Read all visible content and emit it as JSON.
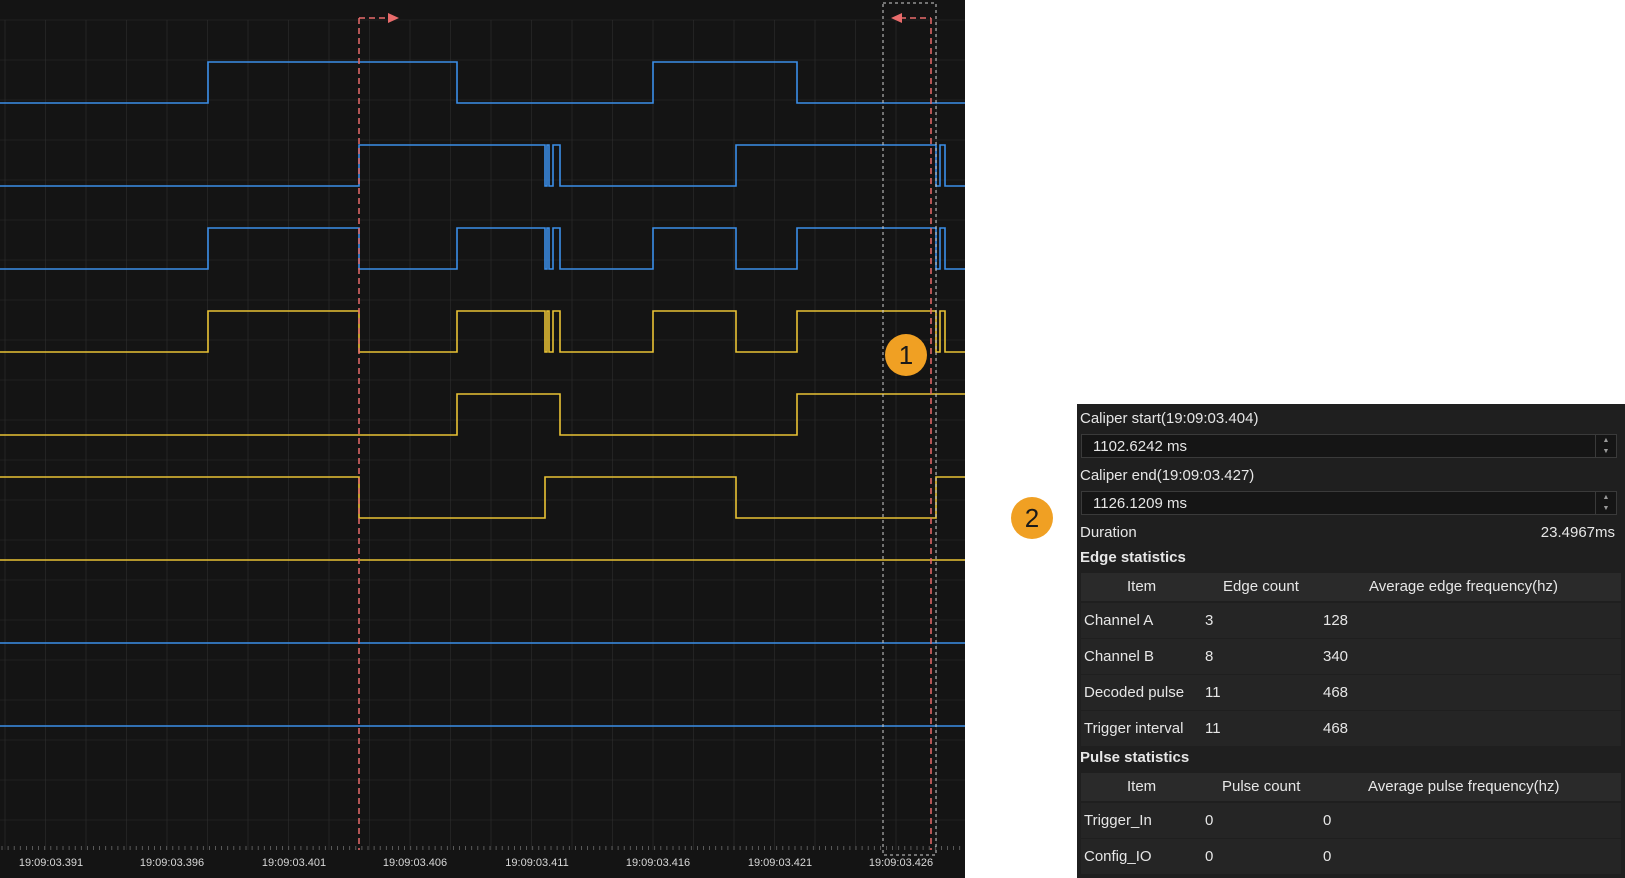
{
  "colors": {
    "blue": "#3b8ee8",
    "yellow": "#e8c234",
    "caliper": "#e86b6b",
    "badge": "#f0a023",
    "grid": "#2e2e2e"
  },
  "waveform": {
    "time_ticks": [
      "19:09:03.391",
      "19:09:03.396",
      "19:09:03.401",
      "19:09:03.406",
      "19:09:03.411",
      "19:09:03.416",
      "19:09:03.421",
      "19:09:03.426"
    ],
    "channels": [
      {
        "color": "blue",
        "segments": [
          [
            0,
            0
          ],
          [
            208,
            0
          ],
          [
            208,
            1
          ],
          [
            457,
            1
          ],
          [
            457,
            0
          ],
          [
            653,
            0
          ],
          [
            653,
            1
          ],
          [
            797,
            1
          ],
          [
            797,
            0
          ],
          [
            965,
            0
          ]
        ]
      },
      {
        "color": "blue",
        "segments": [
          [
            0,
            0
          ],
          [
            359,
            0
          ],
          [
            359,
            1
          ],
          [
            545,
            1
          ],
          [
            545,
            0
          ],
          [
            547,
            0
          ],
          [
            547,
            1
          ],
          [
            549,
            1
          ],
          [
            549,
            0
          ],
          [
            553,
            0
          ],
          [
            553,
            1
          ],
          [
            560,
            1
          ],
          [
            560,
            0
          ],
          [
            736,
            0
          ],
          [
            736,
            1
          ],
          [
            936,
            1
          ],
          [
            936,
            0
          ],
          [
            940,
            0
          ],
          [
            940,
            1
          ],
          [
            945,
            1
          ],
          [
            945,
            0
          ],
          [
            965,
            0
          ]
        ]
      },
      {
        "color": "blue",
        "segments": [
          [
            0,
            0
          ],
          [
            208,
            0
          ],
          [
            208,
            1
          ],
          [
            359,
            1
          ],
          [
            359,
            0
          ],
          [
            457,
            0
          ],
          [
            457,
            1
          ],
          [
            545,
            1
          ],
          [
            545,
            0
          ],
          [
            547,
            0
          ],
          [
            547,
            1
          ],
          [
            549,
            1
          ],
          [
            549,
            0
          ],
          [
            553,
            0
          ],
          [
            553,
            1
          ],
          [
            560,
            1
          ],
          [
            560,
            0
          ],
          [
            653,
            0
          ],
          [
            653,
            1
          ],
          [
            736,
            1
          ],
          [
            736,
            0
          ],
          [
            797,
            0
          ],
          [
            797,
            1
          ],
          [
            936,
            1
          ],
          [
            936,
            0
          ],
          [
            940,
            0
          ],
          [
            940,
            1
          ],
          [
            945,
            1
          ],
          [
            945,
            0
          ],
          [
            965,
            0
          ]
        ]
      },
      {
        "color": "yellow",
        "segments": [
          [
            0,
            0
          ],
          [
            208,
            0
          ],
          [
            208,
            1
          ],
          [
            359,
            1
          ],
          [
            359,
            0
          ],
          [
            457,
            0
          ],
          [
            457,
            1
          ],
          [
            545,
            1
          ],
          [
            545,
            0
          ],
          [
            547,
            0
          ],
          [
            547,
            1
          ],
          [
            549,
            1
          ],
          [
            549,
            0
          ],
          [
            553,
            0
          ],
          [
            553,
            1
          ],
          [
            560,
            1
          ],
          [
            560,
            0
          ],
          [
            653,
            0
          ],
          [
            653,
            1
          ],
          [
            736,
            1
          ],
          [
            736,
            0
          ],
          [
            797,
            0
          ],
          [
            797,
            1
          ],
          [
            936,
            1
          ],
          [
            936,
            0
          ],
          [
            940,
            0
          ],
          [
            940,
            1
          ],
          [
            945,
            1
          ],
          [
            945,
            0
          ],
          [
            965,
            0
          ]
        ]
      },
      {
        "color": "yellow",
        "segments": [
          [
            0,
            0
          ],
          [
            457,
            0
          ],
          [
            457,
            1
          ],
          [
            560,
            1
          ],
          [
            560,
            0
          ],
          [
            797,
            0
          ],
          [
            797,
            1
          ],
          [
            965,
            1
          ]
        ]
      },
      {
        "color": "yellow",
        "segments": [
          [
            0,
            1
          ],
          [
            359,
            1
          ],
          [
            359,
            0
          ],
          [
            545,
            0
          ],
          [
            545,
            1
          ],
          [
            736,
            1
          ],
          [
            736,
            0
          ],
          [
            936,
            0
          ],
          [
            936,
            1
          ],
          [
            965,
            1
          ]
        ]
      },
      {
        "color": "yellow",
        "segments": [
          [
            0,
            1
          ],
          [
            965,
            1
          ]
        ]
      },
      {
        "color": "blue",
        "segments": [
          [
            0,
            1
          ],
          [
            965,
            1
          ]
        ]
      },
      {
        "color": "blue",
        "segments": [
          [
            0,
            1
          ],
          [
            965,
            1
          ]
        ]
      }
    ]
  },
  "markers": {
    "one": "1",
    "two": "2"
  },
  "stats": {
    "caliper_start_label": "Caliper start(19:09:03.404)",
    "caliper_start_value": "1102.6242 ms",
    "caliper_end_label": "Caliper end(19:09:03.427)",
    "caliper_end_value": "1126.1209 ms",
    "duration_label": "Duration",
    "duration_value": "23.4967ms",
    "edge_title": "Edge statistics",
    "edge_headers": [
      "Item",
      "Edge count",
      "Average edge frequency(hz)"
    ],
    "edge_rows": [
      [
        "Channel A",
        "3",
        "128"
      ],
      [
        "Channel B",
        "8",
        "340"
      ],
      [
        "Decoded pulse",
        "11",
        "468"
      ],
      [
        "Trigger interval",
        "11",
        "468"
      ]
    ],
    "pulse_title": "Pulse statistics",
    "pulse_headers": [
      "Item",
      "Pulse count",
      "Average pulse frequency(hz)"
    ],
    "pulse_rows": [
      [
        "Trigger_In",
        "0",
        "0"
      ],
      [
        "Config_IO",
        "0",
        "0"
      ]
    ]
  }
}
